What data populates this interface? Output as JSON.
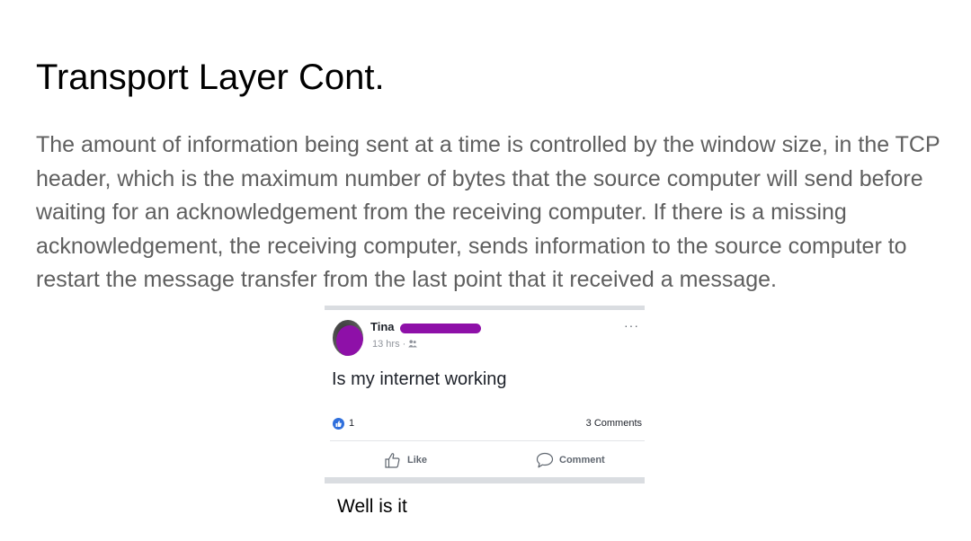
{
  "slide": {
    "title": "Transport Layer Cont.",
    "body": "The amount of information being sent at a time is controlled by the window size, in the TCP header, which is the maximum number of bytes that the source computer will send before waiting for an acknowledgement from the receiving computer. If there is a missing acknowledgement, the receiving computer, sends information to the source computer to restart the message transfer from the last point that it received a message.",
    "caption": "Well is it"
  },
  "post": {
    "author": "Tina",
    "time": "13 hrs",
    "meta_separator": "·",
    "audience_icon": "friends-icon",
    "more_label": "···",
    "text": "Is my internet working",
    "reaction_icon": "thumbs-up-icon",
    "reaction_count": "1",
    "comments_count": "3 Comments",
    "like_label": "Like",
    "comment_label": "Comment",
    "colors": {
      "redaction": "#8e10a8",
      "like_blue": "#2f6fdc",
      "divider": "#dadde1"
    }
  }
}
